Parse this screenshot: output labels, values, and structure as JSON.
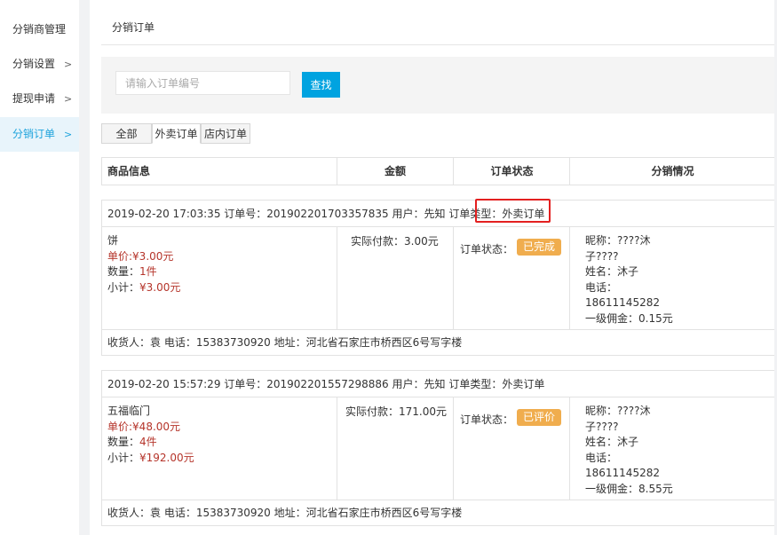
{
  "sidebar": {
    "items": [
      {
        "label": "分销商管理",
        "chevron": false,
        "active": false
      },
      {
        "label": "分销设置",
        "chevron": true,
        "active": false
      },
      {
        "label": "提现申请",
        "chevron": true,
        "active": false
      },
      {
        "label": "分销订单",
        "chevron": true,
        "active": true
      }
    ],
    "chevron_glyph": ">"
  },
  "page": {
    "title": "分销订单"
  },
  "search": {
    "placeholder": "请输入订单编号",
    "value": "",
    "button_label": "查找"
  },
  "tabs": [
    {
      "label": "全部",
      "active": false
    },
    {
      "label": "外卖订单",
      "active": true
    },
    {
      "label": "店内订单",
      "active": false
    }
  ],
  "table": {
    "headers": [
      "商品信息",
      "金额",
      "订单状态",
      "分销情况"
    ]
  },
  "orders": [
    {
      "header_prefix": "2019-02-20 17:03:35 订单号：201902201703357835 用户：先知 订单类型：",
      "order_type": "外卖订单",
      "goods": {
        "name": "饼",
        "price_label": "单价:",
        "price": "¥3.00元",
        "qty_label": "数量：",
        "qty": "1件",
        "subtotal_label": "小计：",
        "subtotal": "¥3.00元"
      },
      "paid": "实际付款：3.00元",
      "status_label": "订单状态：",
      "status": "已完成",
      "dist": {
        "nickname_line1": "昵称：????沐",
        "nickname_line2": "子????",
        "name": "姓名：沐子",
        "phone_label": "电话：",
        "phone": "18611145282",
        "commission": "一级佣金：0.15元"
      },
      "address": "收货人：袁 电话：15383730920 地址：河北省石家庄市桥西区6号写字楼"
    },
    {
      "header_prefix": "2019-02-20 15:57:29 订单号：201902201557298886 用户：先知 订单类型：",
      "order_type": "外卖订单",
      "goods": {
        "name": "五福临门",
        "price_label": "单价:",
        "price": "¥48.00元",
        "qty_label": "数量：",
        "qty": "4件",
        "subtotal_label": "小计：",
        "subtotal": "¥192.00元"
      },
      "paid": "实际付款：171.00元",
      "status_label": "订单状态：",
      "status": "已评价",
      "dist": {
        "nickname_line1": "昵称：????沐",
        "nickname_line2": "子????",
        "name": "姓名：沐子",
        "phone_label": "电话：",
        "phone": "18611145282",
        "commission": "一级佣金：8.55元"
      },
      "address": "收货人：袁 电话：15383730920 地址：河北省石家庄市桥西区6号写字楼"
    }
  ],
  "colors": {
    "accent": "#00a3e0",
    "sidebar_active_bg": "#e8f4fb",
    "sidebar_active_text": "#1ea3dc",
    "badge": "#f0ad4e",
    "price_red": "#b5342a",
    "highlight_red": "#e32020"
  }
}
